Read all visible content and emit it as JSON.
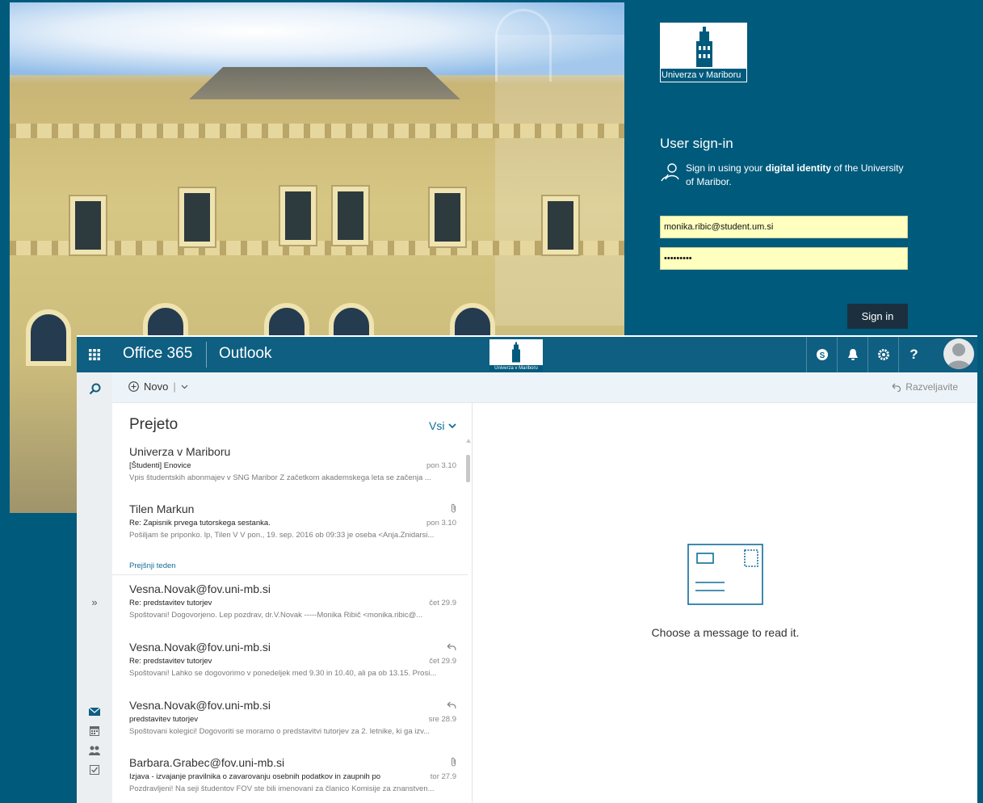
{
  "signin": {
    "logo_caption": "Univerza v Mariboru",
    "title": "User sign-in",
    "desc_start": "Sign in using your ",
    "desc_bold": "digital identity",
    "desc_end": " of the University of Maribor.",
    "username": "monika.ribic@student.um.si",
    "password": "•••••••••",
    "button": "Sign in"
  },
  "outlook": {
    "suite": "Office 365",
    "app": "Outlook",
    "logo_caption": "Univerza v Mariboru",
    "new_label": "Novo",
    "undo_label": "Razveljavite",
    "folder": "Prejeto",
    "filter": "Vsi",
    "group_prev_week": "Prejšnji teden",
    "messages": [
      {
        "sender": "Univerza v Mariboru",
        "subject": "[Študenti] Enovice",
        "date": "pon 3.10",
        "preview": "Vpis študentskih abonmajev v SNG Maribor   Z začetkom akademskega leta se začenja ..."
      },
      {
        "sender": "Tilen Markun",
        "subject": "Re: Zapisnik prvega tutorskega sestanka.",
        "date": "pon 3.10",
        "preview": "Pošiljam še priponko.  lp, Tilen  V V pon., 19. sep. 2016 ob 09:33 je oseba <Anja.Znidarsi..."
      },
      {
        "sender": "Vesna.Novak@fov.uni-mb.si",
        "subject": "Re: predstavitev tutorjev",
        "date": "čet 29.9",
        "preview": "Spoštovani!  Dogovorjeno.  Lep pozdrav, dr.V.Novak  -----Monika Ribič <monika.ribic@..."
      },
      {
        "sender": "Vesna.Novak@fov.uni-mb.si",
        "subject": "Re: predstavitev tutorjev",
        "date": "čet 29.9",
        "preview": "Spoštovani!  Lahko se dogovorimo v ponedeljek med 9.30 in 10.40, ali pa ob 13.15. Prosi..."
      },
      {
        "sender": "Vesna.Novak@fov.uni-mb.si",
        "subject": "predstavitev tutorjev",
        "date": "sre 28.9",
        "preview": "Spoštovani kolegici!  Dogovoriti se moramo o predstavitvi tutorjev za 2. letnike, ki ga izv..."
      },
      {
        "sender": "Barbara.Grabec@fov.uni-mb.si",
        "subject": "Izjava - izvajanje pravilnika o zavarovanju osebnih podatkov in zaupnih po",
        "date": "tor 27.9",
        "preview": "Pozdravljeni!  Na seji študentov FOV ste bili imenovani za članico Komisije za znanstven..."
      }
    ],
    "reading_hint": "Choose a message to read it."
  },
  "icons": {
    "waffle": "waffle-icon",
    "search": "search-icon",
    "skype": "skype-icon",
    "bell": "bell-icon",
    "gear": "gear-icon",
    "help": "help-icon",
    "mail": "mail-icon",
    "calendar": "calendar-icon",
    "people": "people-icon",
    "tasks": "tasks-icon",
    "expand": "expand-icon"
  },
  "colors": {
    "brand": "#005a7c",
    "topbar": "#0e5f82",
    "input_bg": "#ffffc0",
    "accent": "#0e6e9a"
  }
}
